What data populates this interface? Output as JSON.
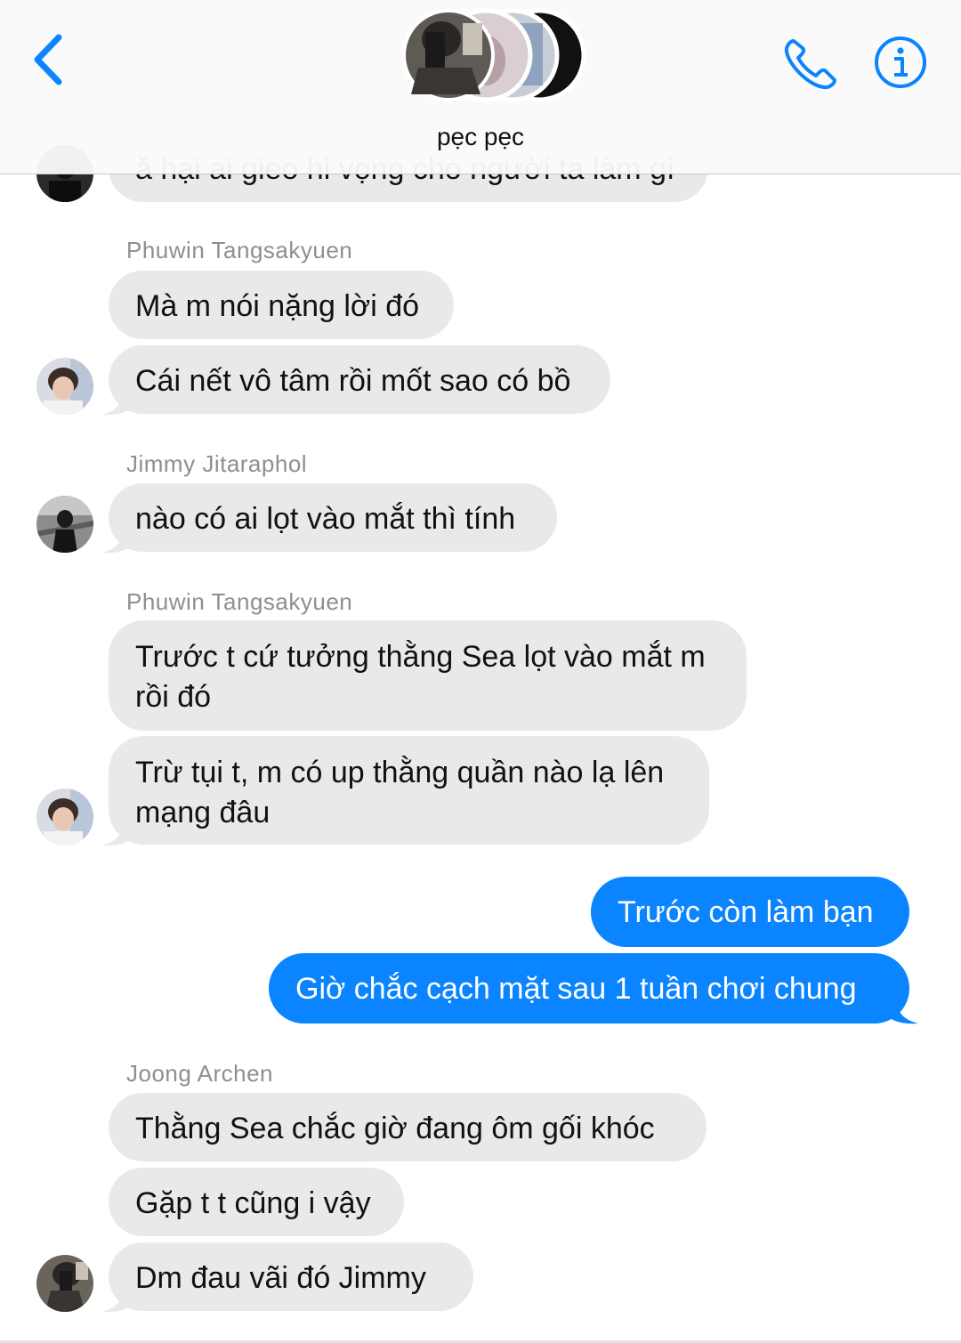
{
  "header": {
    "group_name": "pẹc pẹc",
    "back_icon": "chevron-left-icon",
    "call_icon": "phone-icon",
    "info_icon": "info-icon",
    "accent_color": "#0a84ff"
  },
  "messages": {
    "partial_top": "ă hại ai gieo hi vọng cho người ta làm gì",
    "sender_1": "Phuwin Tangsakyuen",
    "msg_1": "Mà m nói nặng lời đó",
    "msg_2": "Cái nết vô tâm rồi mốt sao có bồ",
    "sender_2": "Jimmy Jitaraphol",
    "msg_3": "nào có ai lọt vào mắt thì tính",
    "sender_3": "Phuwin Tangsakyuen",
    "msg_4": "Trước t cứ tưởng thằng Sea lọt vào mắt m rồi đó",
    "msg_5": "Trừ tụi t, m có up thằng quần nào lạ lên mạng đâu",
    "sent_1": "Trước còn làm bạn",
    "sent_2": "Giờ chắc cạch mặt sau 1 tuần chơi chung",
    "sender_4": "Joong Archen",
    "msg_6": "Thằng Sea chắc giờ đang ôm gối khóc",
    "msg_7": "Gặp t t cũng i vậy",
    "msg_8": "Dm đau vãi đó Jimmy"
  },
  "colors": {
    "received_bubble": "#e9e9eb",
    "sent_bubble": "#0a84ff",
    "sender_name": "#8e8e93"
  }
}
